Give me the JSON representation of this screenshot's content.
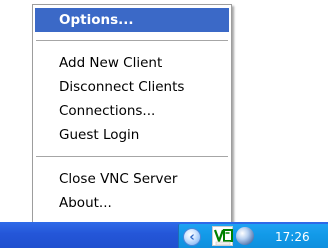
{
  "menu": {
    "items": [
      {
        "label": "Options..."
      },
      {
        "label": "Add New Client"
      },
      {
        "label": "Disconnect Clients"
      },
      {
        "label": "Connections..."
      },
      {
        "label": "Guest Login"
      },
      {
        "label": "Close VNC Server"
      },
      {
        "label": "About..."
      }
    ],
    "highlight_color": "#3b69c7"
  },
  "tray": {
    "clock": "17:26",
    "icons": [
      "show-hidden-icons-chevron",
      "vnc-server-icon",
      "network-globe-icon"
    ]
  }
}
